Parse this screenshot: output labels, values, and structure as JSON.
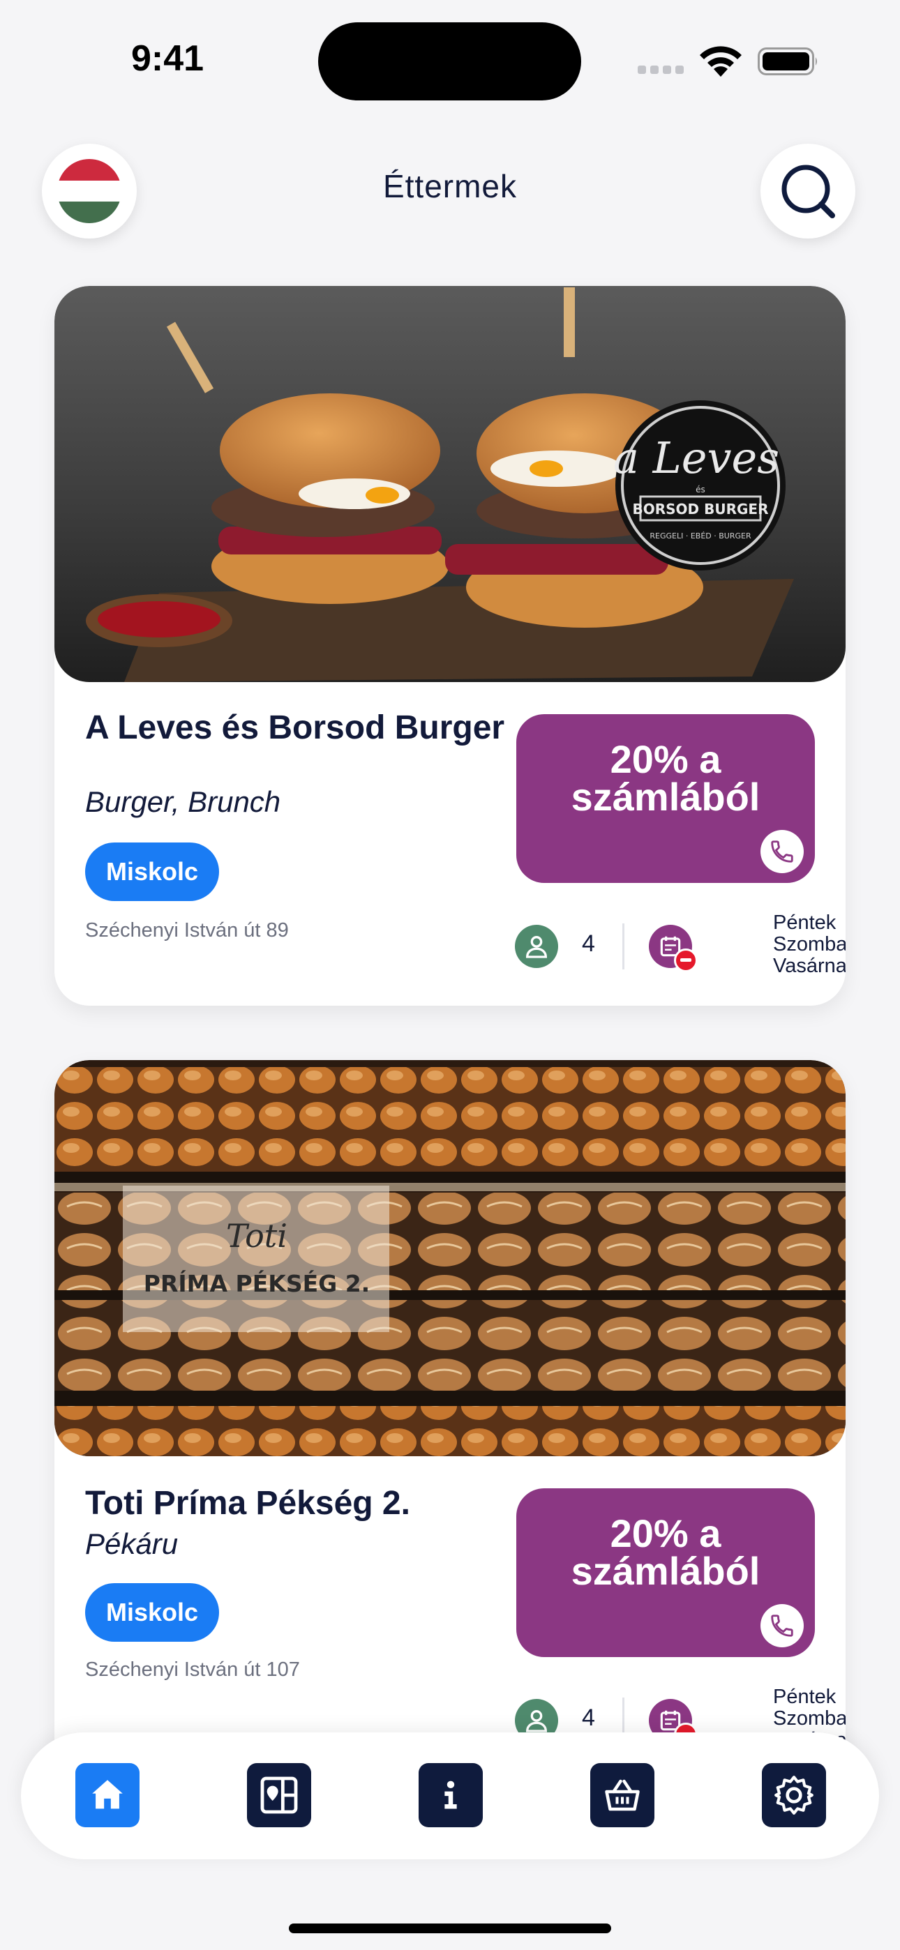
{
  "status_bar": {
    "time": "9:41"
  },
  "header": {
    "title": "Éttermek",
    "language_flag": "hungary-flag-icon",
    "search_icon": "search-icon"
  },
  "restaurants": [
    {
      "name": "A Leves és Borsod Burger",
      "category": "Burger, Brunch",
      "city": "Miskolc",
      "address": "Széchenyi István út 89",
      "discount": "20% a számlából",
      "person_count": "4",
      "closed_days": [
        "Péntek",
        "Szombat",
        "Vasárnap"
      ],
      "image_logo": {
        "line1": "a Leves",
        "line2": "és",
        "line3": "BORSOD BURGER",
        "line4": "REGGELI · EBÉD · BURGER"
      }
    },
    {
      "name": "Toti Príma Pékség 2.",
      "category": "Pékáru",
      "city": "Miskolc",
      "address": "Széchenyi István út 107",
      "discount": "20% a számlából",
      "person_count": "4",
      "closed_days": [
        "Péntek",
        "Szombat",
        "Vasárnap"
      ],
      "image_logo": {
        "line1": "Toti",
        "line2": "PRÍMA PÉKSÉG 2."
      }
    }
  ],
  "bottom_nav": [
    {
      "name": "home",
      "icon": "home-icon",
      "active": true
    },
    {
      "name": "map",
      "icon": "map-icon",
      "active": false
    },
    {
      "name": "info",
      "icon": "info-icon",
      "active": false
    },
    {
      "name": "basket",
      "icon": "basket-icon",
      "active": false
    },
    {
      "name": "settings",
      "icon": "gear-icon",
      "active": false
    }
  ],
  "colors": {
    "accent_blue": "#1a7cf4",
    "discount_purple": "#8b3783",
    "navy": "#0f1b3d",
    "person_green": "#4f8a6d",
    "closed_red": "#e5192b"
  }
}
